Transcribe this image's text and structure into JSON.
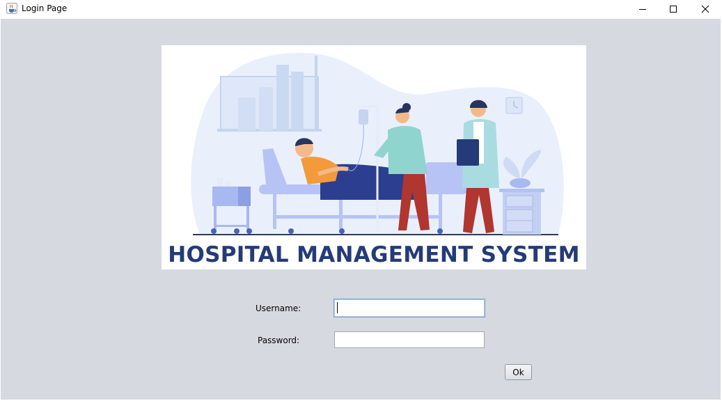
{
  "window": {
    "title": "Login Page",
    "icon": "java-cup-icon",
    "controls": [
      "minimize-icon",
      "maximize-icon",
      "close-icon"
    ]
  },
  "banner": {
    "title": "HOSPITAL MANAGEMENT SYSTEM",
    "title_color": "#243b78"
  },
  "form": {
    "username_label": "Username:",
    "username_value": "",
    "password_label": "Password:",
    "password_value": "",
    "ok_label": "Ok"
  },
  "colors": {
    "background": "#d6d9e0",
    "accent_blue": "#243b78",
    "input_focus_border": "#7a9cc6"
  }
}
